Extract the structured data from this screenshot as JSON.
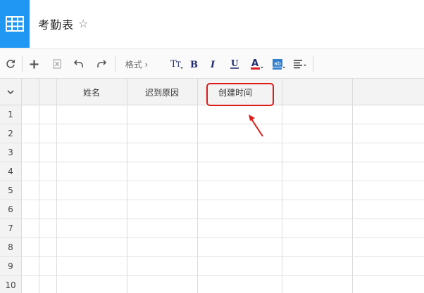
{
  "app": {
    "icon_name": "table-grid-icon",
    "accent_color": "#1f97f3",
    "title": "考勤表",
    "favorite_icon": "star-outline-icon"
  },
  "toolbar": {
    "format_label": "格式 ›",
    "tools": [
      "refresh-icon",
      "add-icon",
      "excel-export-icon",
      "undo-icon",
      "redo-icon",
      "text-size-icon",
      "bold-icon",
      "italic-icon",
      "underline-icon",
      "font-color-icon",
      "fill-color-icon",
      "align-icon"
    ],
    "font_color": "#e02020",
    "fill_color": "#2f7fd0"
  },
  "sheet": {
    "columns": [
      "",
      "",
      "姓名",
      "迟到原因",
      "创建时间",
      ""
    ],
    "rows": [
      "1",
      "2",
      "3",
      "4",
      "5",
      "6",
      "7",
      "8",
      "9",
      "10"
    ]
  },
  "annotation": {
    "color": "#e01919",
    "target": "创建时间"
  }
}
